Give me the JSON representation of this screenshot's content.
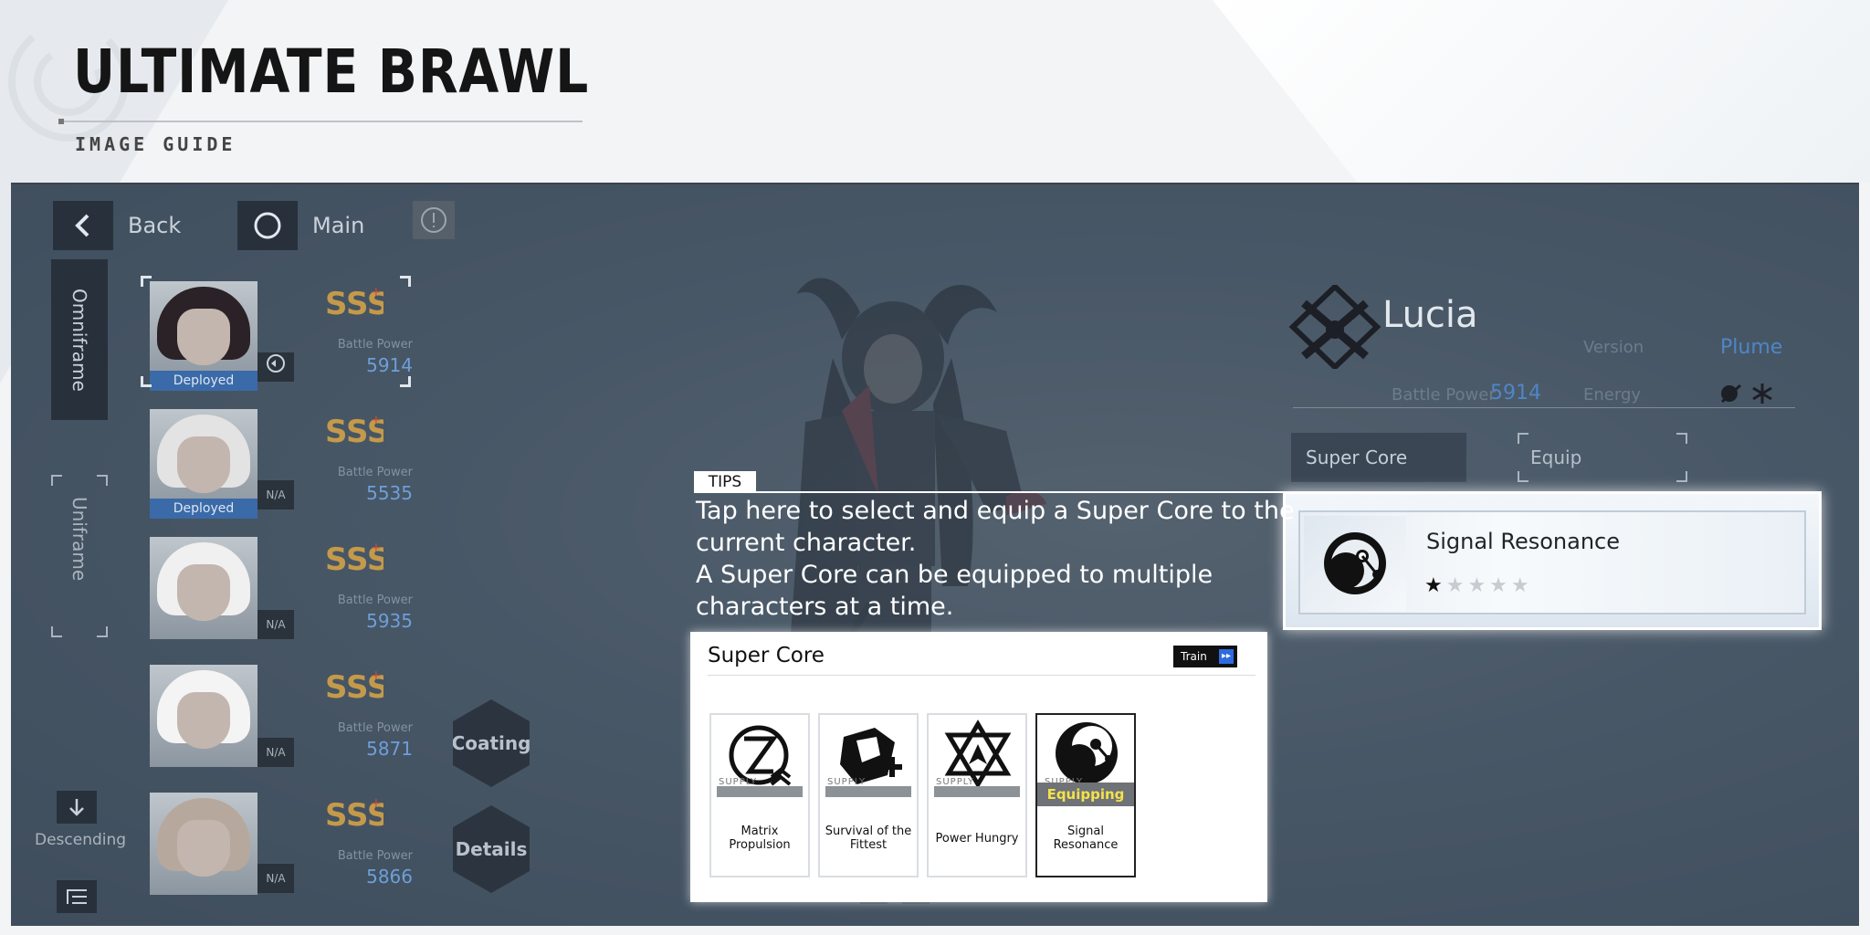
{
  "header": {
    "title": "ULTIMATE BRAWL",
    "subtitle": "IMAGE GUIDE"
  },
  "topbar": {
    "back_label": "Back",
    "main_label": "Main"
  },
  "left_tabs": {
    "omniframe": "Omniframe",
    "uniframe": "Uniframe"
  },
  "roster": [
    {
      "status": "Deployed",
      "bp_label": "Battle Power",
      "bp_value": "5914",
      "hair": "#2a2226"
    },
    {
      "status": "Deployed",
      "side_badge": "N/A",
      "bp_label": "Battle Power",
      "bp_value": "5535",
      "hair": "#e3e3e3"
    },
    {
      "side_badge": "N/A",
      "bp_label": "Battle Power",
      "bp_value": "5935",
      "hair": "#f0f0f0"
    },
    {
      "side_badge": "N/A",
      "bp_label": "Battle Power",
      "bp_value": "5871",
      "hair": "#f4f4f4"
    },
    {
      "side_badge": "N/A",
      "bp_label": "Battle Power",
      "bp_value": "5866",
      "hair": "#b7a89d"
    }
  ],
  "sort": {
    "label": "Descending"
  },
  "actions": {
    "coating": "Coating",
    "details": "Details"
  },
  "character": {
    "name": "Lucia",
    "bp_label": "Battle Power",
    "bp_value": "5914",
    "version_label": "Version",
    "version_value": "Plume",
    "energy_label": "Energy"
  },
  "tabs": {
    "super_core": "Super Core",
    "equip": "Equip"
  },
  "equipped_core": {
    "name": "Signal Resonance",
    "stars_filled": 1,
    "stars_total": 5,
    "star_filled_glyph": "★",
    "star_empty_glyph": "★★★★"
  },
  "tips": {
    "badge": "TIPS",
    "line1": "Tap here to select and equip a Super Core to the",
    "line2": "current character.",
    "line3": "A Super Core can be equipped to multiple",
    "line4": "characters at a time."
  },
  "popup": {
    "title": "Super Core",
    "train_label": "Train",
    "train_arrow": "▸▸",
    "cores": [
      {
        "name": "Matrix Propulsion",
        "supply": "SUPPLY"
      },
      {
        "name": "Survival of the Fittest",
        "supply": "SUPPLY"
      },
      {
        "name": "Power Hungry",
        "supply": "SUPPLY"
      },
      {
        "name": "Signal Resonance",
        "supply": "SUPPLY",
        "status": "Equipping"
      }
    ]
  },
  "colors": {
    "accent_blue": "#4f86c6",
    "deployed_blue": "#3b6aa8",
    "equipping_yellow": "#f4e24a"
  }
}
